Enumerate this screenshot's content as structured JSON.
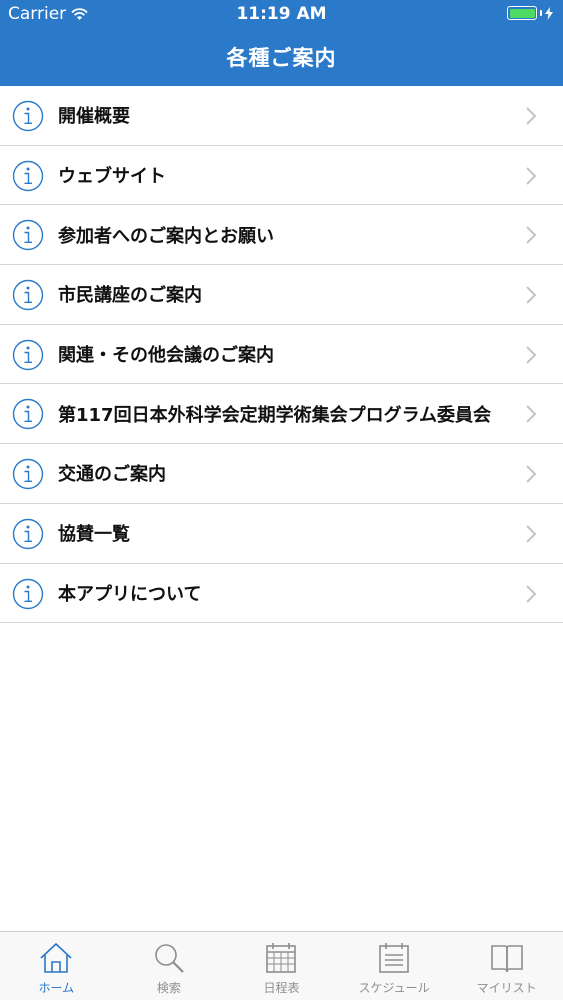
{
  "status_bar": {
    "carrier": "Carrier",
    "time": "11:19 AM"
  },
  "header": {
    "title": "各種ご案内"
  },
  "menu": {
    "items": [
      {
        "label": "開催概要"
      },
      {
        "label": "ウェブサイト"
      },
      {
        "label": "参加者へのご案内とお願い"
      },
      {
        "label": "市民講座のご案内"
      },
      {
        "label": "関連・その他会議のご案内"
      },
      {
        "label": "第117回日本外科学会定期学術集会プログラム委員会"
      },
      {
        "label": "交通のご案内"
      },
      {
        "label": "協賛一覧"
      },
      {
        "label": "本アプリについて"
      }
    ]
  },
  "tabbar": {
    "tabs": [
      {
        "label": "ホーム",
        "icon": "home-icon",
        "active": true
      },
      {
        "label": "検索",
        "icon": "search-icon",
        "active": false
      },
      {
        "label": "日程表",
        "icon": "calendar-icon",
        "active": false
      },
      {
        "label": "スケジュール",
        "icon": "schedule-icon",
        "active": false
      },
      {
        "label": "マイリスト",
        "icon": "book-icon",
        "active": false
      }
    ]
  },
  "colors": {
    "accent": "#2b79c9",
    "battery": "#4cd964",
    "inactive": "#8e8e8e"
  }
}
